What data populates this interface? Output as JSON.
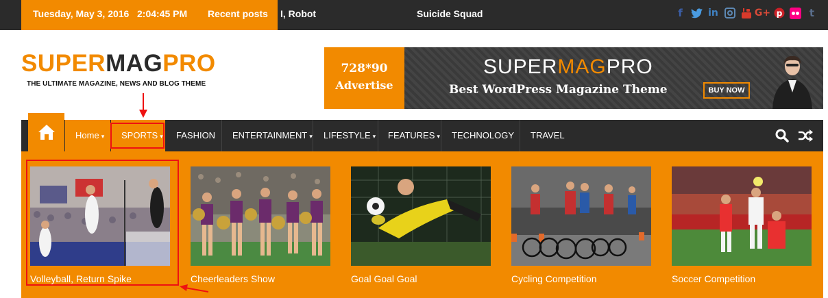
{
  "topbar": {
    "date": "Tuesday, May 3, 2016",
    "time": "2:04:45 PM",
    "recent_label": "Recent posts",
    "ticker": [
      "I, Robot",
      "Suicide Squad"
    ],
    "social_icons": [
      "facebook-icon",
      "twitter-icon",
      "linkedin-icon",
      "instagram-icon",
      "youtube-icon",
      "google-plus-icon",
      "pinterest-icon",
      "flickr-icon",
      "tumblr-icon"
    ]
  },
  "header": {
    "logo": {
      "part1": "SUPER",
      "part2": "MAG",
      "part3": "PRO"
    },
    "tagline": "THE ULTIMATE MAGAZINE, NEWS AND BLOG THEME"
  },
  "ad": {
    "size": "728*90",
    "advertise": "Advertise",
    "brand_super": "SUPER",
    "brand_mag": "MAG",
    "brand_pro": "PRO",
    "subtitle": "Best WordPress Magazine Theme",
    "buy": "BUY NOW"
  },
  "nav": {
    "items": [
      {
        "label": "Home",
        "dropdown": true
      },
      {
        "label": "SPORTS",
        "dropdown": true
      },
      {
        "label": "FASHION",
        "dropdown": false
      },
      {
        "label": "ENTERTAINMENT",
        "dropdown": true
      },
      {
        "label": "LIFESTYLE",
        "dropdown": true
      },
      {
        "label": "FEATURES",
        "dropdown": true
      },
      {
        "label": "TECHNOLOGY",
        "dropdown": false
      },
      {
        "label": "TRAVEL",
        "dropdown": false
      }
    ],
    "caret": "▾"
  },
  "mega": {
    "posts": [
      {
        "title": "Volleyball, Return Spike"
      },
      {
        "title": "Cheerleaders Show"
      },
      {
        "title": "Goal Goal Goal"
      },
      {
        "title": "Cycling Competition"
      },
      {
        "title": "Soccer Competition"
      }
    ]
  },
  "colors": {
    "accent": "#f28a00",
    "dark": "#2b2b2b",
    "annotation": "#ee1111"
  }
}
